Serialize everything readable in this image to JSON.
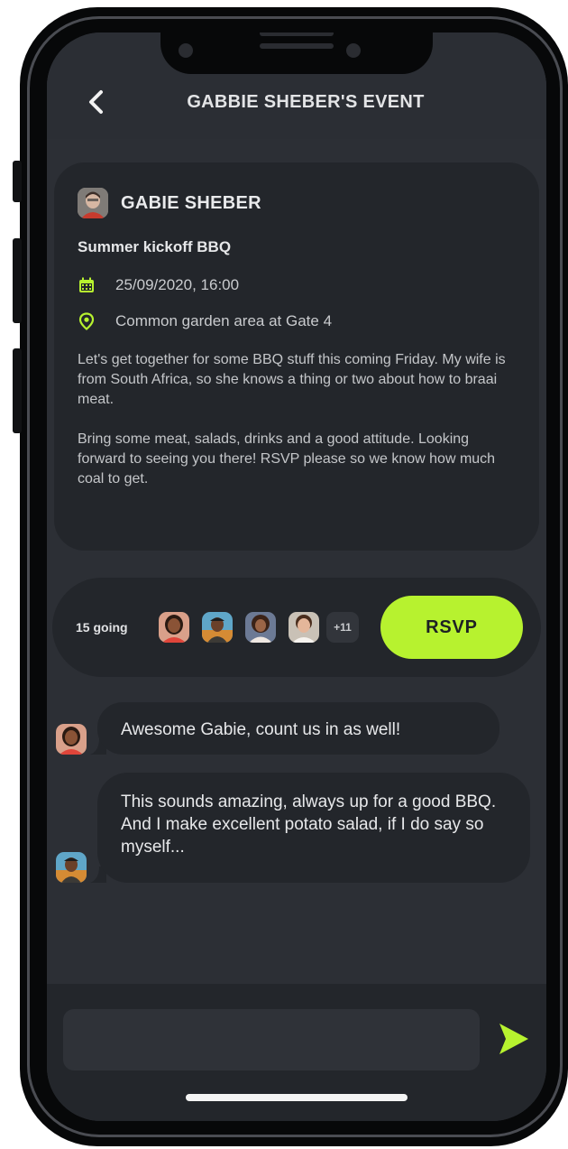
{
  "header": {
    "title": "GABBIE SHEBER'S EVENT",
    "back_icon": "chevron-left-icon"
  },
  "event": {
    "host_name": "GABIE SHEBER",
    "title": "Summer kickoff BBQ",
    "date_time": "25/09/2020, 16:00",
    "location": "Common garden area at Gate 4",
    "description_1": "Let's get together for some BBQ stuff this coming Friday. My wife is from South Africa, so she knows a thing or two about how to braai meat.",
    "description_2": "Bring some meat, salads, drinks and a good attitude. Looking forward to seeing you there! RSVP please so we know how much coal to get.",
    "calendar_icon": "calendar-icon",
    "location_icon": "location-pin-icon"
  },
  "attendance": {
    "going_label": "15 going",
    "more_label": "+11",
    "rsvp_label": "RSVP"
  },
  "messages": [
    {
      "text": "Awesome Gabie, count us in as well!"
    },
    {
      "text": "This sounds amazing, always up for a good BBQ. And I make excellent potato salad, if I do say so myself..."
    }
  ],
  "composer": {
    "placeholder": "",
    "send_icon": "send-icon"
  },
  "colors": {
    "accent": "#b7f22f",
    "background": "#2c2f35",
    "card": "#23262b"
  }
}
